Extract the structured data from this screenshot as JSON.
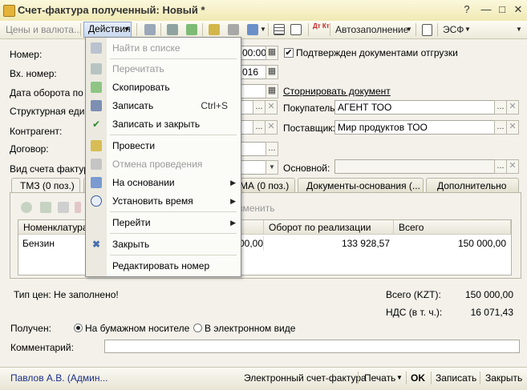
{
  "window": {
    "title": "Счет-фактура полученный: Новый *",
    "help_btn": "?",
    "minimize_btn": "—",
    "maximize_btn": "□",
    "close_btn": "✕"
  },
  "toolbar": {
    "prices_currency": "Цены и валюта...",
    "actions": "Действия",
    "autofill": "Автозаполнение",
    "esf": "ЭСФ",
    "dt_kt": "Дт Кт"
  },
  "form": {
    "number_label": "Номер:",
    "number_value": "00:00",
    "confirmed_checkbox": "Подтвержден документами отгрузки",
    "in_number_label": "Вх. номер:",
    "in_date_value": "016",
    "turnover_date_label": "Дата оборота по р",
    "reverse_link": "Сторнировать документ",
    "structural_unit_label": "Структурная едини",
    "buyer_label": "Покупатель:",
    "buyer_value": "АГЕНТ ТОО",
    "counterparty_label": "Контрагент:",
    "supplier_label": "Поставщик:",
    "supplier_value": "Мир продуктов ТОО",
    "contract_label": "Договор:",
    "invoice_kind_label": "Вид счета фактуры",
    "main_label": "Основной:",
    "btn_dots": "...",
    "btn_clear": "✕",
    "btn_calendar": "▦"
  },
  "tabs": [
    {
      "label": "ТМЗ (0 поз.)"
    },
    {
      "label": "МА (0 поз.)"
    },
    {
      "label": "Документы-основания (..."
    },
    {
      "label": "Дополнительно"
    }
  ],
  "grid": {
    "change_btn": "зменить",
    "columns": [
      "Номенклатура",
      "Оборот по реализации",
      "Всего"
    ],
    "rows": [
      {
        "name": "Бензин",
        "partial": "00,00",
        "turnover": "133 928,57",
        "total": "150 000,00"
      }
    ]
  },
  "summary": {
    "price_type": "Тип цен: Не заполнено!",
    "total_label": "Всего (KZT):",
    "total_value": "150 000,00",
    "vat_label": "НДС (в т. ч.):",
    "vat_value": "16 071,43"
  },
  "received": {
    "label": "Получен:",
    "paper": "На бумажном носителе",
    "electronic": "В электронном виде"
  },
  "comment_label": "Комментарий:",
  "menu": {
    "items": [
      {
        "label": "Найти в списке",
        "shortcut": "",
        "disabled": true
      },
      {
        "label": "Перечитать",
        "shortcut": "",
        "disabled": true
      },
      {
        "label": "Скопировать",
        "shortcut": "",
        "disabled": false
      },
      {
        "label": "Записать",
        "shortcut": "Ctrl+S",
        "disabled": false
      },
      {
        "label": "Записать и закрыть",
        "shortcut": "",
        "disabled": false
      },
      {
        "label": "Провести",
        "shortcut": "",
        "disabled": false
      },
      {
        "label": "Отмена проведения",
        "shortcut": "",
        "disabled": true
      },
      {
        "label": "На основании",
        "shortcut": "",
        "disabled": false
      },
      {
        "label": "Установить время",
        "shortcut": "",
        "disabled": false
      },
      {
        "label": "Перейти",
        "shortcut": "",
        "disabled": false
      },
      {
        "label": "Закрыть",
        "shortcut": "",
        "disabled": false
      },
      {
        "label": "Редактировать номер",
        "shortcut": "",
        "disabled": false
      }
    ]
  },
  "footer": {
    "author": "Павлов А.В. (Админ...",
    "esf_link": "Электронный счет-фактура",
    "print": "Печать",
    "ok": "OK",
    "save": "Записать",
    "close": "Закрыть"
  }
}
